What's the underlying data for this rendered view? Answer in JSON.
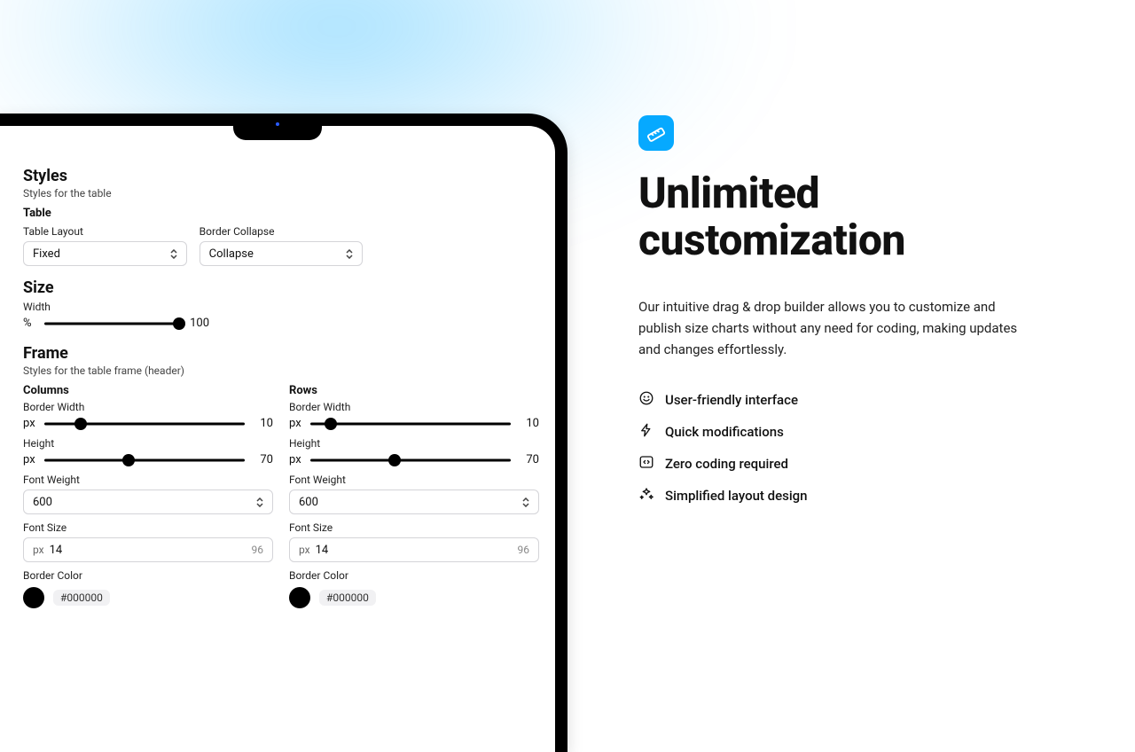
{
  "styles": {
    "title": "Styles",
    "subtitle": "Styles for the table",
    "table": {
      "heading": "Table",
      "tableLayout": {
        "label": "Table Layout",
        "value": "Fixed"
      },
      "borderCollapse": {
        "label": "Border Collapse",
        "value": "Collapse"
      }
    }
  },
  "size": {
    "title": "Size",
    "width": {
      "label": "Width",
      "unit": "%",
      "value": 100,
      "pct": 99
    }
  },
  "frame": {
    "title": "Frame",
    "subtitle": "Styles for the table frame (header)",
    "columns": {
      "heading": "Columns",
      "borderWidth": {
        "label": "Border Width",
        "unit": "px",
        "value": 10,
        "pct": 18
      },
      "height": {
        "label": "Height",
        "unit": "px",
        "value": 70,
        "pct": 42
      },
      "fontWeight": {
        "label": "Font Weight",
        "value": "600"
      },
      "fontSize": {
        "label": "Font Size",
        "unit": "px",
        "value": 14,
        "max": 96
      },
      "borderColor": {
        "label": "Border Color",
        "hex": "#000000"
      }
    },
    "rows": {
      "heading": "Rows",
      "borderWidth": {
        "label": "Border Width",
        "unit": "px",
        "value": 10,
        "pct": 10
      },
      "height": {
        "label": "Height",
        "unit": "px",
        "value": 70,
        "pct": 42
      },
      "fontWeight": {
        "label": "Font Weight",
        "value": "600"
      },
      "fontSize": {
        "label": "Font Size",
        "unit": "px",
        "value": 14,
        "max": 96
      },
      "borderColor": {
        "label": "Border Color",
        "hex": "#000000"
      }
    }
  },
  "hero": {
    "title": "Unlimited customization",
    "desc": "Our intuitive drag & drop builder allows you to customize and publish size charts without any need for coding, making updates and changes effortlessly.",
    "features": [
      "User-friendly interface",
      "Quick modifications",
      "Zero coding required",
      "Simplified layout design"
    ]
  }
}
